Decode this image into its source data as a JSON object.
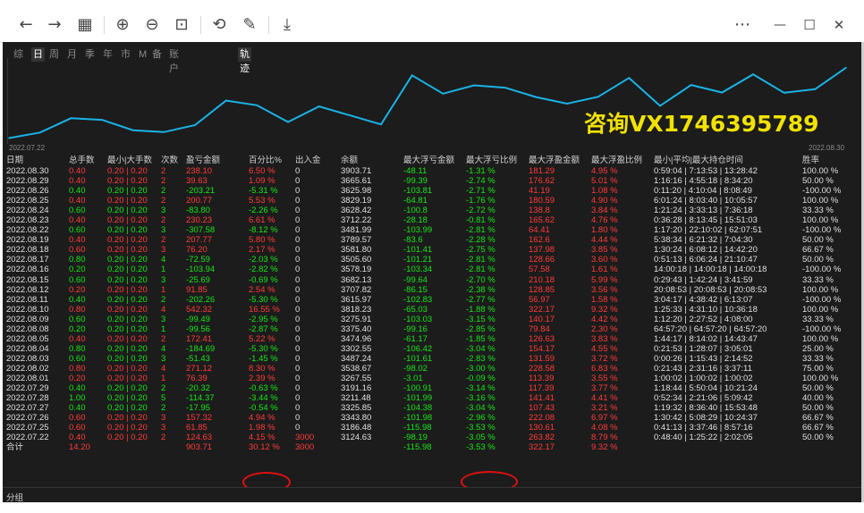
{
  "toolbar": {
    "back_icon": "←",
    "forward_icon": "→",
    "grid_icon": "▦",
    "zoom_in_icon": "⊕",
    "zoom_out_icon": "⊖",
    "fit_icon": "⊡",
    "rotate_icon": "⟲",
    "edit_icon": "✎",
    "save_icon": "⤓",
    "more_icon": "⋯",
    "minimize_icon": "—",
    "maximize_icon": "☐",
    "close_icon": "✕"
  },
  "tabs": [
    {
      "label": "综",
      "active": false
    },
    {
      "label": "日",
      "active": true
    },
    {
      "label": "周",
      "active": false
    },
    {
      "label": "月",
      "active": false
    },
    {
      "label": "季",
      "active": false
    },
    {
      "label": "年",
      "active": false
    },
    {
      "label": "市",
      "active": false
    },
    {
      "label": "M",
      "active": false
    },
    {
      "label": "备",
      "active": false
    },
    {
      "label": "账户",
      "active": false
    },
    {
      "label": "轨迹",
      "active": true
    }
  ],
  "watermark": "咨询VX1746395789",
  "chart_data": {
    "type": "line",
    "x": [
      "2022.07.22",
      "2022.07.25",
      "2022.07.26",
      "2022.07.27",
      "2022.07.28",
      "2022.07.29",
      "2022.08.01",
      "2022.08.02",
      "2022.08.03",
      "2022.08.04",
      "2022.08.05",
      "2022.08.08",
      "2022.08.09",
      "2022.08.10",
      "2022.08.11",
      "2022.08.12",
      "2022.08.15",
      "2022.08.16",
      "2022.08.17",
      "2022.08.18",
      "2022.08.19",
      "2022.08.22",
      "2022.08.23",
      "2022.08.24",
      "2022.08.25",
      "2022.08.26",
      "2022.08.29",
      "2022.08.30"
    ],
    "series": [
      {
        "values": [
          3124.63,
          3186.48,
          3343.8,
          3325.85,
          3211.48,
          3191.16,
          3267.55,
          3538.67,
          3487.24,
          3302.55,
          3474.96,
          3375.4,
          3275.91,
          3818.23,
          3615.97,
          3707.82,
          3682.13,
          3578.19,
          3505.6,
          3581.8,
          3789.57,
          3481.99,
          3712.22,
          3628.42,
          3829.19,
          3625.98,
          3665.61,
          3903.71
        ],
        "color": "#1ab3e6"
      }
    ],
    "x_start_label": "2022.07.22",
    "x_end_label": "2022.08.30",
    "ylim": [
      3100,
      3950
    ],
    "grid": false
  },
  "table": {
    "headers": [
      "日期",
      "总手数",
      "最小|大手数",
      "次数",
      "盈亏金额",
      "百分比%",
      "出入金",
      "余额",
      "最大浮亏金额",
      "最大浮亏比例",
      "最大浮盈金额",
      "最大浮盈比例",
      "最小|平均|最大持仓时间",
      "胜率"
    ],
    "rows": [
      {
        "date": "2022.08.30",
        "lots": "0.40",
        "minmax": "0.20 | 0.20",
        "count": "2",
        "pnl": "238.10",
        "pct": "6.50 %",
        "io": "0",
        "balance": "3903.71",
        "maxloss": "-48.11",
        "maxlosspct": "-1.31 %",
        "maxprofit": "181.29",
        "maxprofitpct": "4.95 %",
        "hold": "0:59:04 | 7:13:53 | 13:28:42",
        "win": "100.00 %",
        "sign": "pos"
      },
      {
        "date": "2022.08.29",
        "lots": "0.40",
        "minmax": "0.20 | 0.20",
        "count": "2",
        "pnl": "39.63",
        "pct": "1.09 %",
        "io": "0",
        "balance": "3665.61",
        "maxloss": "-99.39",
        "maxlosspct": "-2.74 %",
        "maxprofit": "176.62",
        "maxprofitpct": "5.01 %",
        "hold": "1:16:16 | 4:55:18 | 8:34:20",
        "win": "50.00 %",
        "sign": "pos"
      },
      {
        "date": "2022.08.26",
        "lots": "0.40",
        "minmax": "0.20 | 0.20",
        "count": "2",
        "pnl": "-203.21",
        "pct": "-5.31 %",
        "io": "0",
        "balance": "3625.98",
        "maxloss": "-103.81",
        "maxlosspct": "-2.71 %",
        "maxprofit": "41.19",
        "maxprofitpct": "1.08 %",
        "hold": "0:11:20 | 4:10:04 | 8:08:49",
        "win": "-100.00 %",
        "sign": "neg"
      },
      {
        "date": "2022.08.25",
        "lots": "0.40",
        "minmax": "0.20 | 0.20",
        "count": "2",
        "pnl": "200.77",
        "pct": "5.53 %",
        "io": "0",
        "balance": "3829.19",
        "maxloss": "-64.81",
        "maxlosspct": "-1.76 %",
        "maxprofit": "180.59",
        "maxprofitpct": "4.90 %",
        "hold": "6:01:24 | 8:03:40 | 10:05:57",
        "win": "100.00 %",
        "sign": "pos"
      },
      {
        "date": "2022.08.24",
        "lots": "0.60",
        "minmax": "0.20 | 0.20",
        "count": "3",
        "pnl": "-83.80",
        "pct": "-2.26 %",
        "io": "0",
        "balance": "3628.42",
        "maxloss": "-100.8",
        "maxlosspct": "-2.72 %",
        "maxprofit": "138.8",
        "maxprofitpct": "3.84 %",
        "hold": "1:21:24 | 3:33:13 | 7:36:18",
        "win": "33.33 %",
        "sign": "neg"
      },
      {
        "date": "2022.08.23",
        "lots": "0.40",
        "minmax": "0.20 | 0.20",
        "count": "2",
        "pnl": "230.23",
        "pct": "6.61 %",
        "io": "0",
        "balance": "3712.22",
        "maxloss": "-28.18",
        "maxlosspct": "-0.81 %",
        "maxprofit": "165.62",
        "maxprofitpct": "4.76 %",
        "hold": "0:36:28 | 8:13:45 | 15:51:03",
        "win": "100.00 %",
        "sign": "pos"
      },
      {
        "date": "2022.08.22",
        "lots": "0.60",
        "minmax": "0.20 | 0.20",
        "count": "3",
        "pnl": "-307.58",
        "pct": "-8.12 %",
        "io": "0",
        "balance": "3481.99",
        "maxloss": "-103.99",
        "maxlosspct": "-2.81 %",
        "maxprofit": "64.41",
        "maxprofitpct": "1.80 %",
        "hold": "1:17:20 | 22:10:02 | 62:07:51",
        "win": "-100.00 %",
        "sign": "neg"
      },
      {
        "date": "2022.08.19",
        "lots": "0.40",
        "minmax": "0.20 | 0.20",
        "count": "2",
        "pnl": "207.77",
        "pct": "5.80 %",
        "io": "0",
        "balance": "3789.57",
        "maxloss": "-83.6",
        "maxlosspct": "-2.28 %",
        "maxprofit": "162.6",
        "maxprofitpct": "4.44 %",
        "hold": "5:38:34 | 6:21:32 | 7:04:30",
        "win": "50.00 %",
        "sign": "pos"
      },
      {
        "date": "2022.08.18",
        "lots": "0.60",
        "minmax": "0.20 | 0.20",
        "count": "3",
        "pnl": "76.20",
        "pct": "2.17 %",
        "io": "0",
        "balance": "3581.80",
        "maxloss": "-101.41",
        "maxlosspct": "-2.75 %",
        "maxprofit": "137.98",
        "maxprofitpct": "3.85 %",
        "hold": "1:30:24 | 6:08:12 | 14:42:20",
        "win": "66.67 %",
        "sign": "pos"
      },
      {
        "date": "2022.08.17",
        "lots": "0.80",
        "minmax": "0.20 | 0.20",
        "count": "4",
        "pnl": "-72.59",
        "pct": "-2.03 %",
        "io": "0",
        "balance": "3505.60",
        "maxloss": "-101.21",
        "maxlosspct": "-2.81 %",
        "maxprofit": "128.66",
        "maxprofitpct": "3.60 %",
        "hold": "0:51:13 | 6:06:24 | 21:10:47",
        "win": "50.00 %",
        "sign": "neg"
      },
      {
        "date": "2022.08.16",
        "lots": "0.20",
        "minmax": "0.20 | 0.20",
        "count": "1",
        "pnl": "-103.94",
        "pct": "-2.82 %",
        "io": "0",
        "balance": "3578.19",
        "maxloss": "-103.34",
        "maxlosspct": "-2.81 %",
        "maxprofit": "57.58",
        "maxprofitpct": "1.61 %",
        "hold": "14:00:18 | 14:00:18 | 14:00:18",
        "win": "-100.00 %",
        "sign": "neg"
      },
      {
        "date": "2022.08.15",
        "lots": "0.60",
        "minmax": "0.20 | 0.20",
        "count": "3",
        "pnl": "-25.69",
        "pct": "-0.69 %",
        "io": "0",
        "balance": "3682.13",
        "maxloss": "-99.64",
        "maxlosspct": "-2.70 %",
        "maxprofit": "210.18",
        "maxprofitpct": "5.99 %",
        "hold": "0:29:43 | 1:42:24 | 3:41:59",
        "win": "33.33 %",
        "sign": "neg"
      },
      {
        "date": "2022.08.12",
        "lots": "0.20",
        "minmax": "0.20 | 0.20",
        "count": "1",
        "pnl": "91.85",
        "pct": "2.54 %",
        "io": "0",
        "balance": "3707.82",
        "maxloss": "-86.15",
        "maxlosspct": "-2.38 %",
        "maxprofit": "128.85",
        "maxprofitpct": "3.56 %",
        "hold": "20:08:53 | 20:08:53 | 20:08:53",
        "win": "100.00 %",
        "sign": "pos"
      },
      {
        "date": "2022.08.11",
        "lots": "0.40",
        "minmax": "0.20 | 0.20",
        "count": "2",
        "pnl": "-202.26",
        "pct": "-5.30 %",
        "io": "0",
        "balance": "3615.97",
        "maxloss": "-102.83",
        "maxlosspct": "-2.77 %",
        "maxprofit": "56.97",
        "maxprofitpct": "1.58 %",
        "hold": "3:04:17 | 4:38:42 | 6:13:07",
        "win": "-100.00 %",
        "sign": "neg"
      },
      {
        "date": "2022.08.10",
        "lots": "0.80",
        "minmax": "0.20 | 0.20",
        "count": "4",
        "pnl": "542.32",
        "pct": "16.55 %",
        "io": "0",
        "balance": "3818.23",
        "maxloss": "-65.03",
        "maxlosspct": "-1.88 %",
        "maxprofit": "322.17",
        "maxprofitpct": "9.32 %",
        "hold": "1:25:33 | 4:31:10 | 10:36:18",
        "win": "100.00 %",
        "sign": "pos"
      },
      {
        "date": "2022.08.09",
        "lots": "0.60",
        "minmax": "0.20 | 0.20",
        "count": "3",
        "pnl": "-99.49",
        "pct": "-2.95 %",
        "io": "0",
        "balance": "3275.91",
        "maxloss": "-103.03",
        "maxlosspct": "-3.15 %",
        "maxprofit": "140.17",
        "maxprofitpct": "4.42 %",
        "hold": "1:12:20 | 2:27:52 | 4:08:00",
        "win": "33.33 %",
        "sign": "neg"
      },
      {
        "date": "2022.08.08",
        "lots": "0.20",
        "minmax": "0.20 | 0.20",
        "count": "1",
        "pnl": "-99.56",
        "pct": "-2.87 %",
        "io": "0",
        "balance": "3375.40",
        "maxloss": "-99.16",
        "maxlosspct": "-2.85 %",
        "maxprofit": "79.84",
        "maxprofitpct": "2.30 %",
        "hold": "64:57:20 | 64:57:20 | 64:57:20",
        "win": "-100.00 %",
        "sign": "neg"
      },
      {
        "date": "2022.08.05",
        "lots": "0.40",
        "minmax": "0.20 | 0.20",
        "count": "2",
        "pnl": "172.41",
        "pct": "5.22 %",
        "io": "0",
        "balance": "3474.96",
        "maxloss": "-61.17",
        "maxlosspct": "-1.85 %",
        "maxprofit": "126.63",
        "maxprofitpct": "3.83 %",
        "hold": "1:44:17 | 8:14:02 | 14:43:47",
        "win": "100.00 %",
        "sign": "pos"
      },
      {
        "date": "2022.08.04",
        "lots": "0.80",
        "minmax": "0.20 | 0.20",
        "count": "4",
        "pnl": "-184.69",
        "pct": "-5.30 %",
        "io": "0",
        "balance": "3302.55",
        "maxloss": "-106.42",
        "maxlosspct": "-3.04 %",
        "maxprofit": "154.17",
        "maxprofitpct": "4.55 %",
        "hold": "0:21:53 | 1:28:07 | 3:05:01",
        "win": "25.00 %",
        "sign": "neg"
      },
      {
        "date": "2022.08.03",
        "lots": "0.60",
        "minmax": "0.20 | 0.20",
        "count": "3",
        "pnl": "-51.43",
        "pct": "-1.45 %",
        "io": "0",
        "balance": "3487.24",
        "maxloss": "-101.61",
        "maxlosspct": "-2.83 %",
        "maxprofit": "131.59",
        "maxprofitpct": "3.72 %",
        "hold": "0:00:26 | 1:15:43 | 2:14:52",
        "win": "33.33 %",
        "sign": "neg"
      },
      {
        "date": "2022.08.02",
        "lots": "0.80",
        "minmax": "0.20 | 0.20",
        "count": "4",
        "pnl": "271.12",
        "pct": "8.30 %",
        "io": "0",
        "balance": "3538.67",
        "maxloss": "-98.02",
        "maxlosspct": "-3.00 %",
        "maxprofit": "228.58",
        "maxprofitpct": "6.83 %",
        "hold": "0:21:43 | 2:31:16 | 3:37:11",
        "win": "75.00 %",
        "sign": "pos"
      },
      {
        "date": "2022.08.01",
        "lots": "0.20",
        "minmax": "0.20 | 0.20",
        "count": "1",
        "pnl": "76.39",
        "pct": "2.39 %",
        "io": "0",
        "balance": "3267.55",
        "maxloss": "-3.01",
        "maxlosspct": "-0.09 %",
        "maxprofit": "113.39",
        "maxprofitpct": "3.55 %",
        "hold": "1:00:02 | 1:00:02 | 1:00:02",
        "win": "100.00 %",
        "sign": "pos"
      },
      {
        "date": "2022.07.29",
        "lots": "0.40",
        "minmax": "0.20 | 0.20",
        "count": "2",
        "pnl": "-20.32",
        "pct": "-0.63 %",
        "io": "0",
        "balance": "3191.16",
        "maxloss": "-100.91",
        "maxlosspct": "-3.14 %",
        "maxprofit": "117.39",
        "maxprofitpct": "3.77 %",
        "hold": "1:18:44 | 5:50:04 | 10:21:24",
        "win": "50.00 %",
        "sign": "neg"
      },
      {
        "date": "2022.07.28",
        "lots": "1.00",
        "minmax": "0.20 | 0.20",
        "count": "5",
        "pnl": "-114.37",
        "pct": "-3.44 %",
        "io": "0",
        "balance": "3211.48",
        "maxloss": "-101.99",
        "maxlosspct": "-3.16 %",
        "maxprofit": "141.41",
        "maxprofitpct": "4.41 %",
        "hold": "0:52:34 | 2:21:06 | 5:09:42",
        "win": "40.00 %",
        "sign": "neg"
      },
      {
        "date": "2022.07.27",
        "lots": "0.40",
        "minmax": "0.20 | 0.20",
        "count": "2",
        "pnl": "-17.95",
        "pct": "-0.54 %",
        "io": "0",
        "balance": "3325.85",
        "maxloss": "-104.38",
        "maxlosspct": "-3.04 %",
        "maxprofit": "107.43",
        "maxprofitpct": "3.21 %",
        "hold": "1:19:32 | 8:36:40 | 15:53:48",
        "win": "50.00 %",
        "sign": "neg"
      },
      {
        "date": "2022.07.26",
        "lots": "0.60",
        "minmax": "0.20 | 0.20",
        "count": "3",
        "pnl": "157.32",
        "pct": "4.94 %",
        "io": "0",
        "balance": "3343.80",
        "maxloss": "-101.98",
        "maxlosspct": "-2.96 %",
        "maxprofit": "222.08",
        "maxprofitpct": "6.97 %",
        "hold": "1:30:42 | 5:08:29 | 10:24:37",
        "win": "66.67 %",
        "sign": "pos"
      },
      {
        "date": "2022.07.25",
        "lots": "0.60",
        "minmax": "0.20 | 0.20",
        "count": "3",
        "pnl": "61.85",
        "pct": "1.98 %",
        "io": "0",
        "balance": "3186.48",
        "maxloss": "-115.98",
        "maxlosspct": "-3.53 %",
        "maxprofit": "130.61",
        "maxprofitpct": "4.08 %",
        "hold": "0:41:13 | 3:37:46 | 8:57:16",
        "win": "66.67 %",
        "sign": "pos"
      },
      {
        "date": "2022.07.22",
        "lots": "0.40",
        "minmax": "0.20 | 0.20",
        "count": "2",
        "pnl": "124.63",
        "pct": "4.15 %",
        "io": "3000",
        "balance": "3124.63",
        "maxloss": "-98.19",
        "maxlosspct": "-3.05 %",
        "maxprofit": "263.82",
        "maxprofitpct": "8.79 %",
        "hold": "0:48:40 | 1:25:22 | 2:02:05",
        "win": "50.00 %",
        "sign": "pos"
      }
    ],
    "total": {
      "label": "合计",
      "lots": "14.20",
      "pnl": "903.71",
      "pct": "30.12 %",
      "io": "3000",
      "maxloss": "-115.98",
      "maxlosspct": "-3.53 %",
      "maxprofit": "322.17",
      "maxprofitpct": "9.32 %"
    }
  },
  "footer": {
    "label": "分组"
  },
  "colors": {
    "positive": "#ff3b3b",
    "negative": "#19e619",
    "line": "#1ab3e6",
    "highlight_ellipse": "#e01010",
    "watermark": "#f2e200"
  }
}
